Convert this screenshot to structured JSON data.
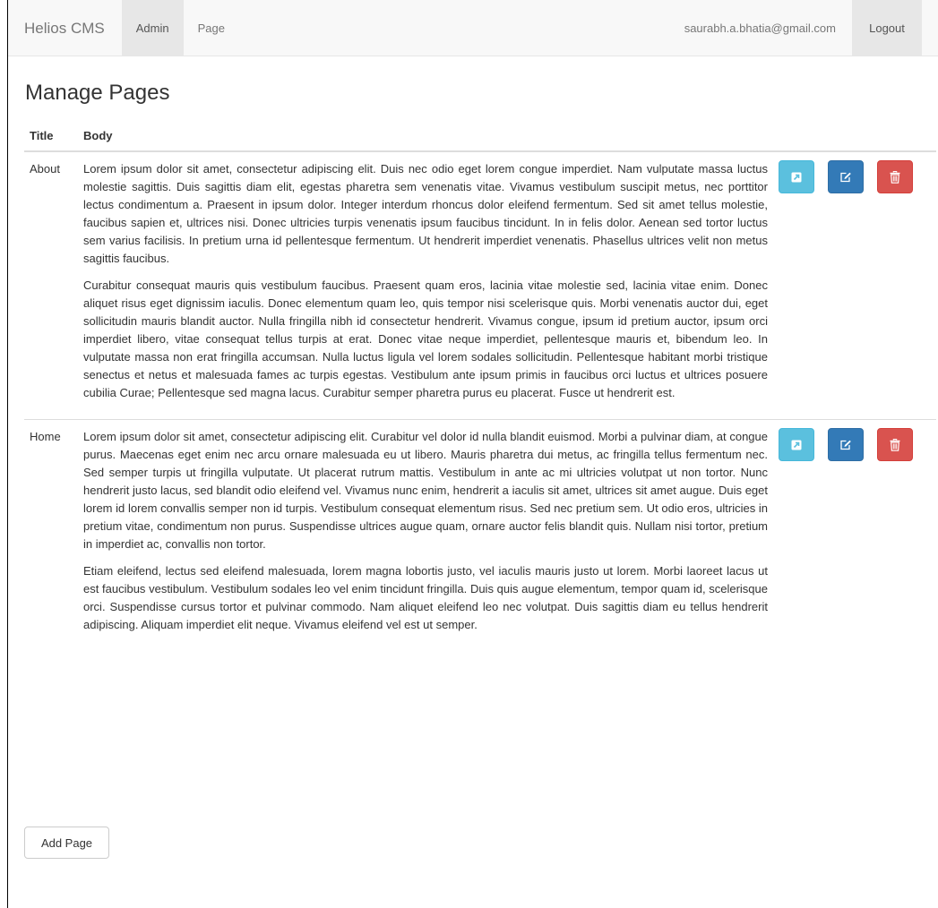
{
  "navbar": {
    "brand": "Helios CMS",
    "links": [
      {
        "label": "Admin"
      },
      {
        "label": "Page"
      }
    ],
    "user_email": "saurabh.a.bhatia@gmail.com",
    "logout_label": "Logout"
  },
  "main": {
    "title": "Manage Pages",
    "columns": [
      "Title",
      "Body"
    ],
    "rows": [
      {
        "title": "About",
        "paragraphs": [
          "Lorem ipsum dolor sit amet, consectetur adipiscing elit. Duis nec odio eget lorem congue imperdiet. Nam vulputate massa luctus molestie sagittis. Duis sagittis diam elit, egestas pharetra sem venenatis vitae. Vivamus vestibulum suscipit metus, nec porttitor lectus condimentum a. Praesent in ipsum dolor. Integer interdum rhoncus dolor eleifend fermentum. Sed sit amet tellus molestie, faucibus sapien et, ultrices nisi. Donec ultricies turpis venenatis ipsum faucibus tincidunt. In in felis dolor. Aenean sed tortor luctus sem varius facilisis. In pretium urna id pellentesque fermentum. Ut hendrerit imperdiet venenatis. Phasellus ultrices velit non metus sagittis faucibus.",
          "Curabitur consequat mauris quis vestibulum faucibus. Praesent quam eros, lacinia vitae molestie sed, lacinia vitae enim. Donec aliquet risus eget dignissim iaculis. Donec elementum quam leo, quis tempor nisi scelerisque quis. Morbi venenatis auctor dui, eget sollicitudin mauris blandit auctor. Nulla fringilla nibh id consectetur hendrerit. Vivamus congue, ipsum id pretium auctor, ipsum orci imperdiet libero, vitae consequat tellus turpis at erat. Donec vitae neque imperdiet, pellentesque mauris et, bibendum leo. In vulputate massa non erat fringilla accumsan. Nulla luctus ligula vel lorem sodales sollicitudin. Pellentesque habitant morbi tristique senectus et netus et malesuada fames ac turpis egestas. Vestibulum ante ipsum primis in faucibus orci luctus et ultrices posuere cubilia Curae; Pellentesque sed magna lacus. Curabitur semper pharetra purus eu placerat. Fusce ut hendrerit est."
        ]
      },
      {
        "title": "Home",
        "paragraphs": [
          "Lorem ipsum dolor sit amet, consectetur adipiscing elit. Curabitur vel dolor id nulla blandit euismod. Morbi a pulvinar diam, at congue purus. Maecenas eget enim nec arcu ornare malesuada eu ut libero. Mauris pharetra dui metus, ac fringilla tellus fermentum nec. Sed semper turpis ut fringilla vulputate. Ut placerat rutrum mattis. Vestibulum in ante ac mi ultricies volutpat ut non tortor. Nunc hendrerit justo lacus, sed blandit odio eleifend vel. Vivamus nunc enim, hendrerit a iaculis sit amet, ultrices sit amet augue. Duis eget lorem id lorem convallis semper non id turpis. Vestibulum consequat elementum risus. Sed nec pretium sem. Ut odio eros, ultricies in pretium vitae, condimentum non purus. Suspendisse ultrices augue quam, ornare auctor felis blandit quis. Nullam nisi tortor, pretium in imperdiet ac, convallis non tortor.",
          "Etiam eleifend, lectus sed eleifend malesuada, lorem magna lobortis justo, vel iaculis mauris justo ut lorem. Morbi laoreet lacus ut est faucibus vestibulum. Vestibulum sodales leo vel enim tincidunt fringilla. Duis quis augue elementum, tempor quam id, scelerisque orci. Suspendisse cursus tortor et pulvinar commodo. Nam aliquet eleifend leo nec volutpat. Duis sagittis diam eu tellus hendrerit adipiscing. Aliquam imperdiet elit neque. Vivamus eleifend vel est ut semper."
        ]
      }
    ],
    "row_actions": [
      {
        "kind": "view",
        "icon": "external-link-icon",
        "color": "#5bc0de"
      },
      {
        "kind": "edit",
        "icon": "edit-icon",
        "color": "#337ab7"
      },
      {
        "kind": "delete",
        "icon": "trash-icon",
        "color": "#d9534f"
      }
    ],
    "add_button_label": "Add Page"
  }
}
